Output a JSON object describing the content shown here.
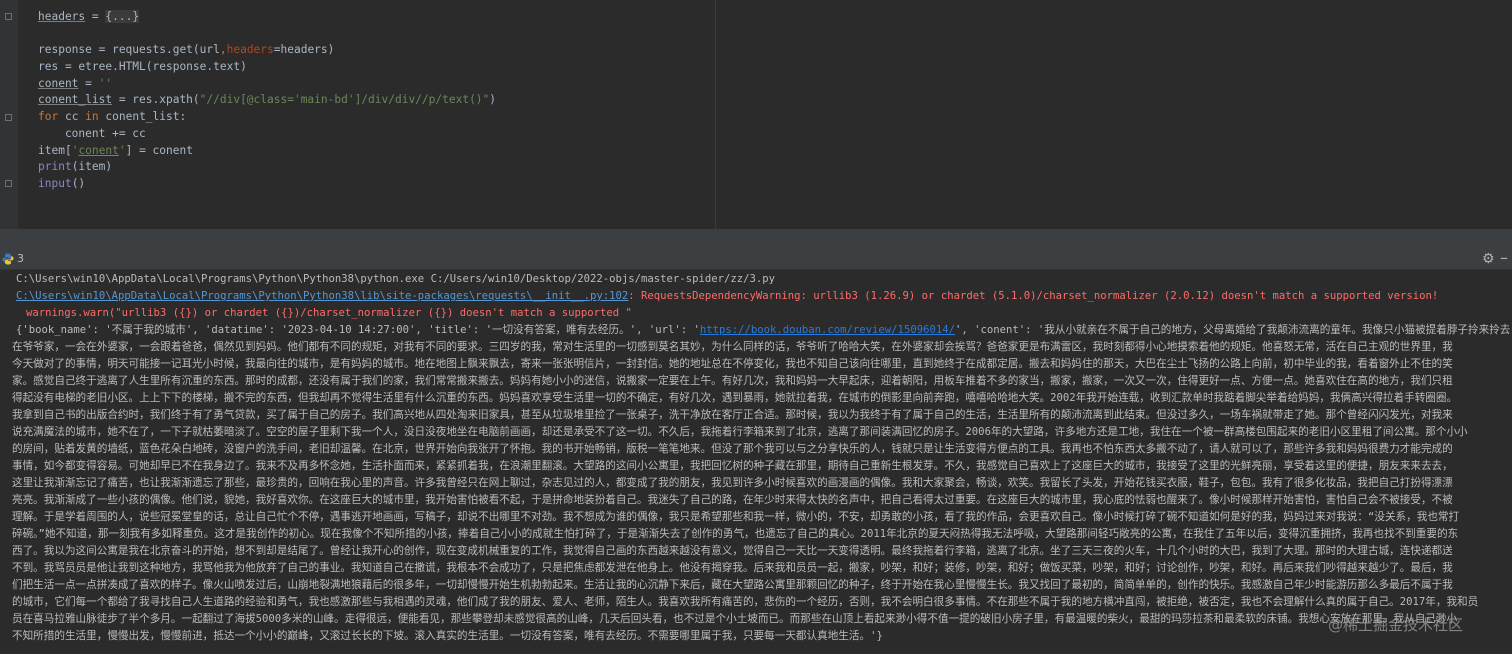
{
  "run": {
    "tab_label": "3"
  },
  "console": {
    "command": "C:\\Users\\win10\\AppData\\Local\\Programs\\Python\\Python38\\python.exe C:/Users/win10/Desktop/2022-objs/master-spider/zz/3.py",
    "warning_path": "C:\\Users\\win10\\AppData\\Local\\Programs\\Python\\Python38\\lib\\site-packages\\requests\\__init__.py:102",
    "warning_text": ": RequestsDependencyWarning: urllib3 (1.26.9) or chardet (5.1.0)/charset_normalizer (2.0.12) doesn't match a supported version!",
    "warning_line2": "warnings.warn(\"urllib3 ({}) or chardet ({})/charset_normalizer ({}) doesn't match a supported \"",
    "output_prefix": "{'book_name': '不属于我的城市', 'datatime': '2023-04-10 14:27:00', 'title': '一切没有答案，唯有去经历。', 'url': '",
    "output_url": "https://book.douban.com/review/15096014/",
    "output_suffix": "', 'conent': '我从小就亲在不属于自己的地方，父母离婚给了我颠沛流离的童年。我像只小猫被提着脖子拎来拎去，一会儿",
    "output_lines": [
      "在爷爷家，一会在外婆家，一会跟着爸爸，偶然见到妈妈。他们都有不同的规矩，对我有不同的要求。三四岁的我，常对生活里的一切感到莫名其妙，为什么同样的话，爷爷听了哈哈大笑，在外婆家却会挨骂？爸爸家更是布满雷区，我时刻都得小心地摸索着他的规矩。他喜怒无常，活在自己主观的世界里，我",
      "今天做对了的事情，明天可能接一记耳光小时候，我最向往的城市，是有妈妈的城市。地在地图上飘来飘去，寄来一张张明信片，一封封信。她的地址总在不停变化，我也不知自己该向往哪里，直到她终于在成都定居。搬去和妈妈住的那天，大巴在尘土飞扬的公路上向前，初中毕业的我，看着窗外止不住的笑",
      "家。感觉自己终于逃离了人生里所有沉重的东西。那时的成都，还没有属于我们的家，我们常常搬来搬去。妈妈有她小小的迷信，说搬家一定要在上午。有好几次，我和妈妈一大早起床，迎着朝阳，用板车推着不多的家当，搬家，搬家，一次又一次，住得更好一点、方便一点。她喜欢住在高的地方，我们只租",
      "得起没有电梯的老旧小区。上上下下的楼梯，搬不完的东西，但我却再不觉得生活里有什么沉重的东西。妈妈喜欢享受生活里一切的不确定，有好几次，遇到暴雨，她就拉着我，在城市的倒影里向前奔跑，嘻嘻哈哈地大笑。2002年我开始连载，收到汇款单时我踮着脚尖举着给妈妈，我俩高兴得拉着手转圈圈。",
      "我拿到自己书的出版合约时，我们终于有了勇气贷款，买了属于自己的房子。我们高兴地从四处淘来旧家具，甚至从垃圾堆里捡了一张桌子，洗干净放在客厅正合适。那时候，我以为我终于有了属于自己的生活，生活里所有的颠沛流离到此结束。但没过多久，一场车祸就带走了她。那个曾经闪闪发光，对我来",
      "说充满魔法的城市，她不在了，一下子就枯萎暗淡了。空空的屋子里剩下我一个人，没日没夜地坐在电脑前画画，却还是承受不了这一切。不久后，我拖着行李箱来到了北京，逃离了那间装满回忆的房子。2006年的大望路，许多地方还是工地，我住在一个被一群高楼包围起来的老旧小区里租了间公寓。那个小小",
      "的房间，贴着发黄的墙纸，蓝色花朵白地砖，没窗户的洗手间，老旧却温馨。在北京，世界开始向我张开了怀抱。我的书开始畅销，版税一笔笔地来。但没了那个我可以与之分享快乐的人，钱就只是让生活变得方便点的工具。我再也不怕东西太多搬不动了，请人就可以了，那些许多我和妈妈很费力才能完成的",
      "事情，如今都变得容易。可她却早已不在我身边了。我来不及再多怀念她，生活扑面而来，紧紧抓着我，在浪潮里翻滚。大望路的这间小公寓里，我把回忆树的种子藏在那里，期待自己重新生根发芽。不久，我感觉自己喜欢上了这座巨大的城市，我接受了这里的光鲜亮丽，享受着这里的便捷，朋友来来去去，",
      "这里让我渐渐忘记了痛苦，也让我渐渐遗忘了那些，最珍贵的，回响在我心里的声音。许多我曾经只在网上聊过，杂志见过的人，都变成了我的朋友，我见到许多小时候喜欢的画漫画的偶像。我和大家聚会，畅谈，欢笑。我留长了头发，开始花钱买衣服，鞋子，包包。我有了很多化妆品，我把自己打扮得漂漂",
      "亮亮。我渐渐成了一些小孩的偶像。他们说，貌她，我好喜欢你。在这座巨大的城市里，我开始害怕被看不起，于是拼命地装扮着自己。我迷失了自己的路，在年少时来得太快的名声中，把自己看得太过重要。在这座巨大的城市里，我心底的怯弱也醒来了。像小时候那样开始害怕，害怕自己会不被接受，不被",
      "理解。于是学着周围的人，说些冠冕堂皇的话，总让自己忙个不停，遇事逃开地画画，写稿子，却说不出哪里不对劲。我不想成为谁的偶像，我只是希望那些和我一样，微小的，不安，却勇敢的小孩，看了我的作品，会更喜欢自己。像小时候打碎了碗不知道如何是好的我，妈妈过来对我说：“没关系，我也常打",
      "碎碗。”她不知道，那一刻我有多如释重负。这才是我创作的初心。现在我像个不知所措的小孩，捧着自己小小的成就生怕打碎了，于是渐渐失去了创作的勇气，也遗忘了自己的真心。2011年北京的夏天闷热得我无法呼吸，大望路那间轻巧敞亮的公寓，在我住了五年以后，变得沉重拥挤，我再也找不到重要的东",
      "西了。我以为这间公寓是我在北京奋斗的开始，想不到却是结尾了。曾经让我开心的创作，现在变成机械重复的工作，我觉得自己画的东西越来越没有意义，觉得自己一天比一天变得透明。最终我拖着行李箱，逃离了北京。坐了三天三夜的火车，十几个小时的大巴，我到了大理。那时的大理古城，连快递都送",
      "不到。我骂员员是他让我到这种地方，我骂他我为他放弃了自己的事业。我知道自己在撒谎，我根本不会成功了，只是把焦虑都发泄在他身上。他没有揭穿我。后来我和员员一起，搬家，吵架，和好；装修，吵架，和好；做饭买菜，吵架，和好；讨论创作，吵架，和好。再后来我们吵得越来越少了。最后，我",
      "们把生活一点一点拼凑成了喜欢的样子。像火山喷发过后，山崩地裂满地狼藉后的很多年，一切却慢慢开始生机勃勃起来。生活让我的心沉静下来后，藏在大望路公寓里那颗回忆的种子，终于开始在我心里慢慢生长。我又找回了最初的，简简单单的，创作的快乐。我感激自己年少时能游历那么多最后不属于我",
      "的城市，它们每一个都给了我寻找自己人生道路的经验和勇气，我也感激那些与我相遇的灵魂，他们成了我的朋友、爱人、老师，陌生人。我喜欢我所有痛苦的，悲伤的一个经历，否则，我不会明白很多事情。不在那些不属于我的地方横冲直闯，被拒绝，被否定，我也不会理解什么真的属于自己。2017年，我和员",
      "员在喜马拉雅山脉徒步了半个多月。一起翻过了海拔5000多米的山峰。走得很远，便能看见，那些攀登却未感觉很高的山峰，几天后回头看，也不过是个小土坡而已。而那些在山顶上看起来渺小得不值一提的破旧小房子里，有最温暖的柴火，最甜的玛莎拉茶和最柔软的床铺。我想心安放在那里。我从自己渺小",
      "不知所措的生活里，慢慢出发，慢慢前进，抵达一个小小的巅峰，又滚过长长的下坡。滚入真实的生活里。一切没有答案，唯有去经历。不需要哪里属于我，只要每一天都认真地生活。'}"
    ]
  },
  "watermark": "@稀土掘金技术社区"
}
